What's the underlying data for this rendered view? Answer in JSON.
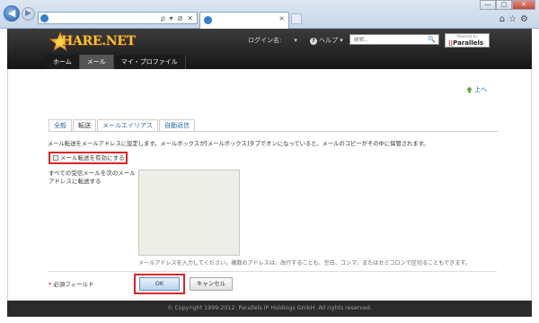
{
  "browser": {
    "address_icons": "ρ ▾ ⊘ ✕",
    "tab_close": "×",
    "tools_icons": "⌂☆⚙",
    "window_controls": [
      "—",
      "▢",
      "✕"
    ]
  },
  "header": {
    "brand": "HARE.NET",
    "login_label": "ログイン名:",
    "login_caret": "▾",
    "help_icon": "?",
    "help_label": "ヘルプ ▾",
    "search_placeholder": "検索...",
    "search_icon": "🔍",
    "parallels_top": "Powered by",
    "parallels_logo": "Parallels",
    "parallels_mark": "||",
    "nav": [
      "ホーム",
      "メール",
      "マイ・プロファイル"
    ]
  },
  "content": {
    "up_link": "上へ",
    "tabs": [
      "全般",
      "転送",
      "メールエイリアス",
      "自動返信"
    ],
    "description": "メール転送をメールアドレスに設定します。メールボックスが[メールボックス]タブでオンになっていると、メールのコピーがその中に保管されます。",
    "checkbox_label": "メール転送を有効にする",
    "forward_label": "すべての受信メールを次のメールアドレスに転送する",
    "textarea_value": "",
    "textarea_hint": "メールアドレスを入力してください。複数のアドレスは、改行することも、空白、コンマ、またはセミコロンで区切ることもできます。",
    "required_star": "*",
    "required_label": "必須フィールド",
    "ok_label": "OK",
    "cancel_label": "キャンセル"
  },
  "footer": {
    "copyright": "© Copyright 1999-2012. Parallels IP Holdings GmbH. All rights reserved."
  },
  "colors": {
    "highlight": "#e0212b",
    "link": "#2a6aa8",
    "header_bg": "#151515"
  }
}
